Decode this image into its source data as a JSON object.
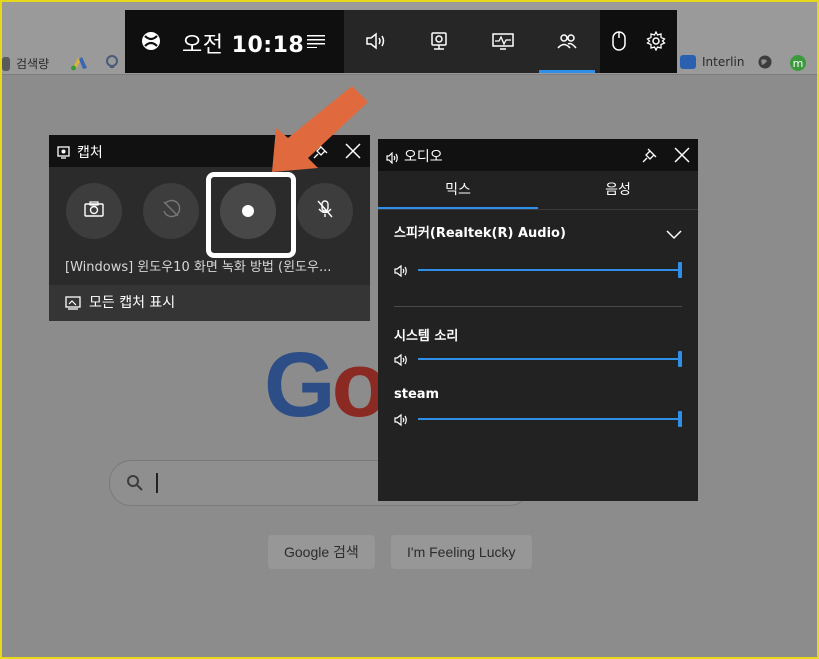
{
  "bookmarks": [
    {
      "label": "검색량",
      "color": "#3a3a3a"
    },
    {
      "label": "",
      "color": "#d8b23a"
    },
    {
      "label": "",
      "color": "#6a7a9a"
    },
    {
      "label": "Interlin",
      "color": "#2b5fb0"
    },
    {
      "label": "",
      "color": "#4a4a4a"
    },
    {
      "label": "",
      "color": "#3c9a3c"
    }
  ],
  "gamebar": {
    "time_prefix": "오전",
    "time": "10:18",
    "icons": [
      "xbox-logo-icon",
      "menu-icon",
      "audio-icon",
      "capture-icon",
      "performance-icon",
      "social-icon",
      "mouse-icon",
      "settings-icon"
    ],
    "accent": "#2f8fe8"
  },
  "capture": {
    "title": "캡처",
    "file_name": "[Windows] 윈도우10 화면 녹화 방법 (윈도우...",
    "show_all": "모든 캡처 표시",
    "buttons": [
      "screenshot",
      "record-last",
      "record",
      "mic"
    ]
  },
  "audio": {
    "title": "오디오",
    "tabs": [
      "믹스",
      "음성"
    ],
    "device": "스피커(Realtek(R) Audio)",
    "device_volume": 1.0,
    "apps": [
      {
        "name": "시스템 소리",
        "volume": 1.0
      },
      {
        "name": "steam",
        "volume": 1.0
      }
    ]
  },
  "google": {
    "logo_visible": "Go",
    "search_button": "Google 검색",
    "lucky_button": "I'm Feeling Lucky"
  },
  "annotation": {
    "arrow_color": "#e06a3e",
    "highlight_color": "#ffffff"
  }
}
